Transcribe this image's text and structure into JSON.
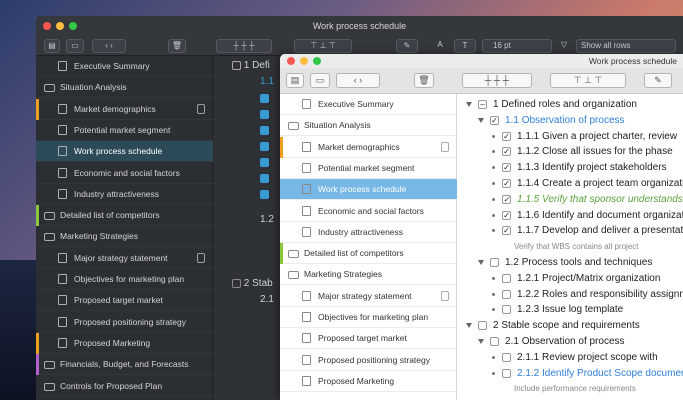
{
  "dark_window": {
    "title": "Work process schedule",
    "font_size": "16 pt",
    "filter": "Show all rows",
    "sidebar": [
      {
        "label": "Executive Summary",
        "icon": "doc-icon",
        "selected": false
      },
      {
        "label": "Situation Analysis",
        "icon": "folder-icon",
        "selected": false
      },
      {
        "label": "Market demographics",
        "icon": "doc-icon",
        "selected": false,
        "locked": true,
        "stripe": "#f0a020"
      },
      {
        "label": "Potential market segment",
        "icon": "doc-icon",
        "selected": false
      },
      {
        "label": "Work process schedule",
        "icon": "doc-icon",
        "selected": true
      },
      {
        "label": "Economic and social factors",
        "icon": "doc-icon",
        "selected": false
      },
      {
        "label": "Industry attractiveness",
        "icon": "doc-icon",
        "selected": false
      },
      {
        "label": "Detailed list of competitors",
        "icon": "folder-icon",
        "selected": false,
        "stripe": "#8cc63f"
      },
      {
        "label": "Marketing Strategies",
        "icon": "folder-icon",
        "selected": false
      },
      {
        "label": "Major strategy statement",
        "icon": "doc-icon",
        "selected": false,
        "locked": true
      },
      {
        "label": "Objectives for marketing plan",
        "icon": "doc-icon",
        "selected": false
      },
      {
        "label": "Proposed target market",
        "icon": "doc-icon",
        "selected": false
      },
      {
        "label": "Proposed positioning strategy",
        "icon": "doc-icon",
        "selected": false
      },
      {
        "label": "Proposed Marketing",
        "icon": "doc-icon",
        "selected": false,
        "stripe": "#f0a020"
      },
      {
        "label": "Financials, Budget, and Forecasts",
        "icon": "folder-icon",
        "selected": false,
        "stripe": "#b060d0"
      },
      {
        "label": "Controls for Proposed Plan",
        "icon": "folder-icon",
        "selected": false
      }
    ],
    "tree": [
      {
        "num": "1",
        "text": "Defi"
      },
      {
        "num": "1.1",
        "text": ""
      },
      {
        "num": "1.2",
        "text": ""
      },
      {
        "num": "2",
        "text": "Stab"
      },
      {
        "num": "2.1",
        "text": ""
      }
    ]
  },
  "light_window": {
    "title": "Work process schedule",
    "sidebar": [
      {
        "label": "Executive Summary",
        "icon": "doc-icon",
        "selected": false
      },
      {
        "label": "Situation Analysis",
        "icon": "folder-icon",
        "selected": false
      },
      {
        "label": "Market demographics",
        "icon": "doc-icon",
        "selected": false,
        "locked": true,
        "stripe": "#f0a020"
      },
      {
        "label": "Potential market segment",
        "icon": "doc-icon",
        "selected": false
      },
      {
        "label": "Work process schedule",
        "icon": "doc-icon",
        "selected": true
      },
      {
        "label": "Economic and social factors",
        "icon": "doc-icon",
        "selected": false
      },
      {
        "label": "Industry attractiveness",
        "icon": "doc-icon",
        "selected": false
      },
      {
        "label": "Detailed list of competitors",
        "icon": "folder-icon",
        "selected": false,
        "stripe": "#8cc63f"
      },
      {
        "label": "Marketing Strategies",
        "icon": "folder-icon",
        "selected": false
      },
      {
        "label": "Major strategy statement",
        "icon": "doc-icon",
        "selected": false,
        "locked": true
      },
      {
        "label": "Objectives for marketing plan",
        "icon": "doc-icon",
        "selected": false
      },
      {
        "label": "Proposed target market",
        "icon": "doc-icon",
        "selected": false
      },
      {
        "label": "Proposed positioning strategy",
        "icon": "doc-icon",
        "selected": false
      },
      {
        "label": "Proposed Marketing",
        "icon": "doc-icon",
        "selected": false
      }
    ],
    "outline": [
      {
        "level": 0,
        "kind": "node",
        "checked": "minus",
        "num": "1",
        "text": "Defined roles and organization",
        "style": ""
      },
      {
        "level": 1,
        "kind": "node",
        "checked": "yes",
        "num": "1.1",
        "text": "Observation of process",
        "style": "blue"
      },
      {
        "level": 2,
        "kind": "leaf",
        "checked": "yes",
        "num": "1.1.1",
        "text": "Given a project charter, review",
        "style": ""
      },
      {
        "level": 2,
        "kind": "leaf",
        "checked": "yes",
        "num": "1.1.2",
        "text": "Close all issues for the phase",
        "style": ""
      },
      {
        "level": 2,
        "kind": "leaf",
        "checked": "yes",
        "num": "1.1.3",
        "text": "Identify project stakeholders",
        "style": ""
      },
      {
        "level": 2,
        "kind": "leaf",
        "checked": "yes",
        "num": "1.1.4",
        "text": "Create a project team organization",
        "style": ""
      },
      {
        "level": 2,
        "kind": "leaf",
        "checked": "yes",
        "num": "1.1.5",
        "text": "Verify that sponsor understands",
        "style": "green"
      },
      {
        "level": 2,
        "kind": "leaf",
        "checked": "yes",
        "num": "1.1.6",
        "text": "Identify and document organization",
        "style": ""
      },
      {
        "level": 2,
        "kind": "leaf",
        "checked": "yes",
        "num": "1.1.7",
        "text": "Develop and deliver a presentation",
        "style": ""
      },
      {
        "level": 3,
        "kind": "note",
        "checked": "none",
        "num": "",
        "text": "Verify that WBS contains all project",
        "style": "note"
      },
      {
        "level": 1,
        "kind": "node",
        "checked": "no",
        "num": "1.2",
        "text": "Process tools and techniques",
        "style": ""
      },
      {
        "level": 2,
        "kind": "leaf",
        "checked": "no",
        "num": "1.2.1",
        "text": "Project/Matrix organization",
        "style": ""
      },
      {
        "level": 2,
        "kind": "leaf",
        "checked": "no",
        "num": "1.2.2",
        "text": "Roles and responsibility assignment",
        "style": ""
      },
      {
        "level": 2,
        "kind": "leaf",
        "checked": "no",
        "num": "1.2.3",
        "text": "Issue log template",
        "style": ""
      },
      {
        "level": 0,
        "kind": "node",
        "checked": "no",
        "num": "2",
        "text": "Stable scope and requirements",
        "style": ""
      },
      {
        "level": 1,
        "kind": "node",
        "checked": "no",
        "num": "2.1",
        "text": "Observation of process",
        "style": ""
      },
      {
        "level": 2,
        "kind": "leaf",
        "checked": "no",
        "num": "2.1.1",
        "text": "Review project scope with",
        "style": ""
      },
      {
        "level": 2,
        "kind": "leaf",
        "checked": "no",
        "num": "2.1.2",
        "text": "Identify Product Scope document",
        "style": "link"
      },
      {
        "level": 3,
        "kind": "note",
        "checked": "none",
        "num": "",
        "text": "Include performance requirements",
        "style": "note"
      }
    ]
  }
}
